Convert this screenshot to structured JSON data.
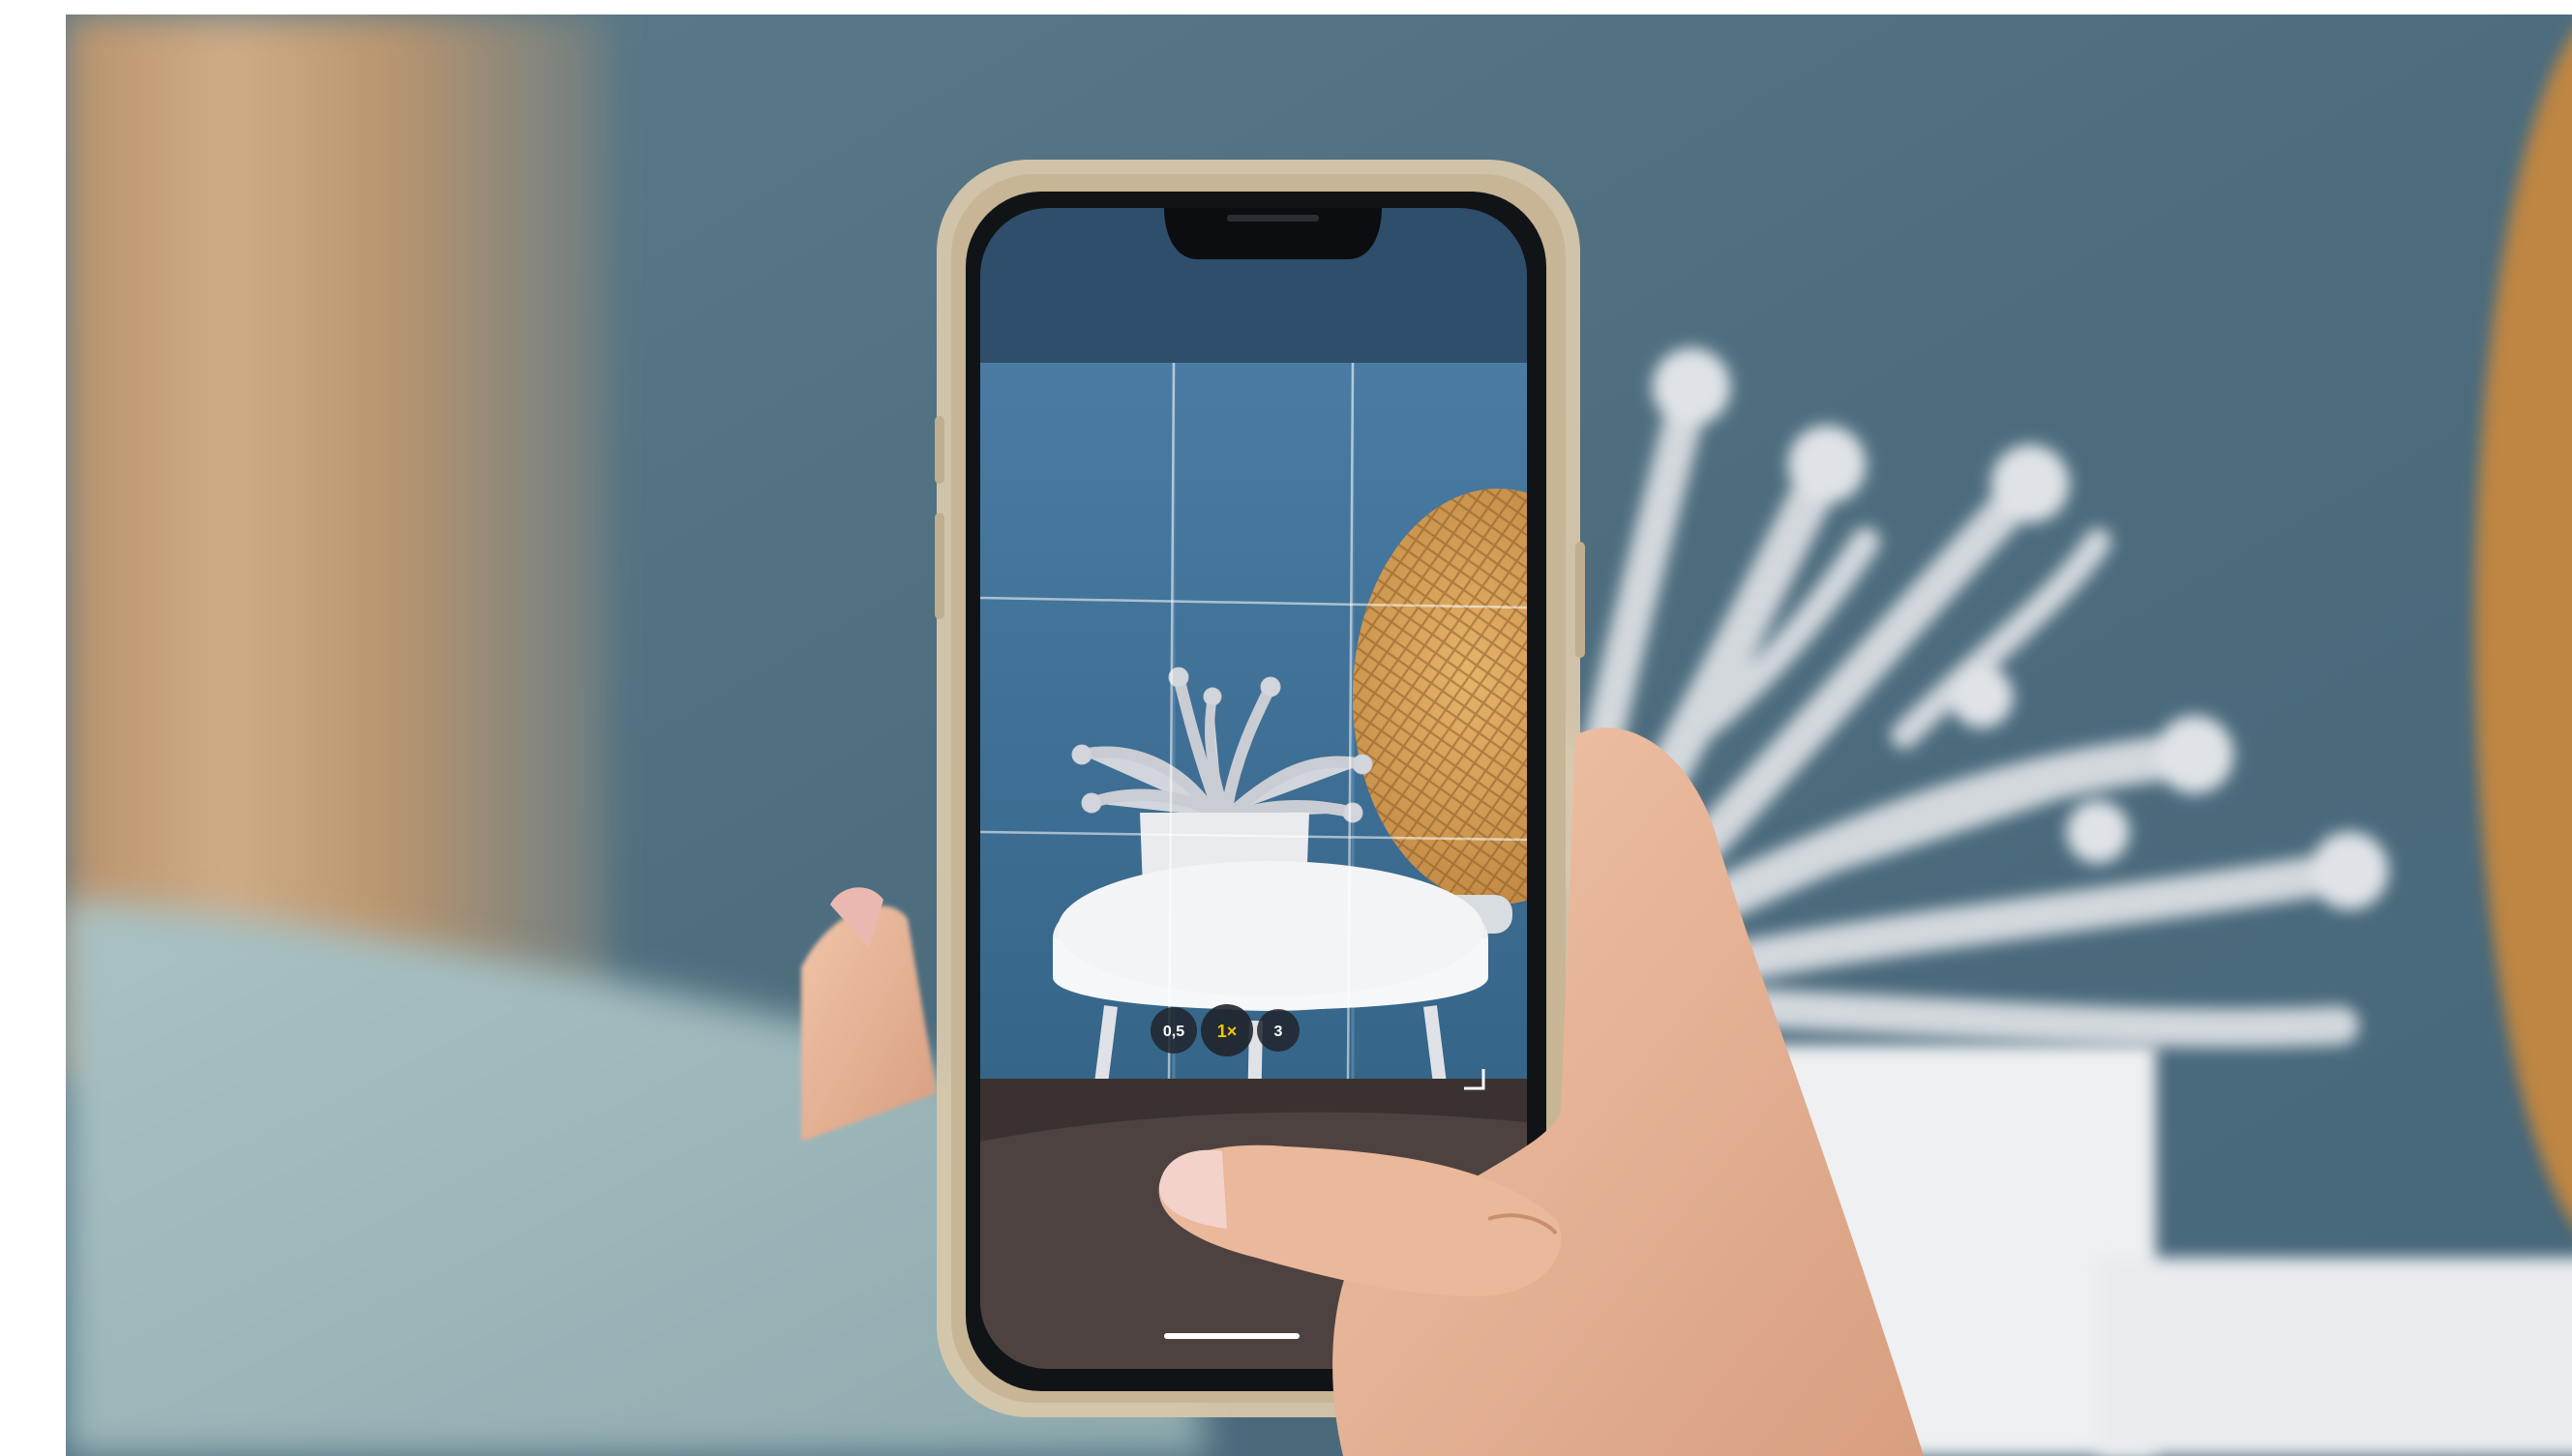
{
  "photo": {
    "camera_ui": {
      "zoom_options": [
        "0,5",
        "1×",
        "3"
      ],
      "selected_zoom": "1×"
    },
    "colors": {
      "wall": "#4f6f80",
      "curtain": "#c19d78",
      "sweater": "#9fb9bc",
      "skin": "#e6b497",
      "nail": "#f0c7c3",
      "phone_case": "#d9c9ae",
      "screen_wall": "#3f6f97",
      "rattan": "#d49a52",
      "table_white": "#f2f2f2",
      "flower_white": "#e4e6ea",
      "zoom_active": "#f5c400"
    }
  }
}
